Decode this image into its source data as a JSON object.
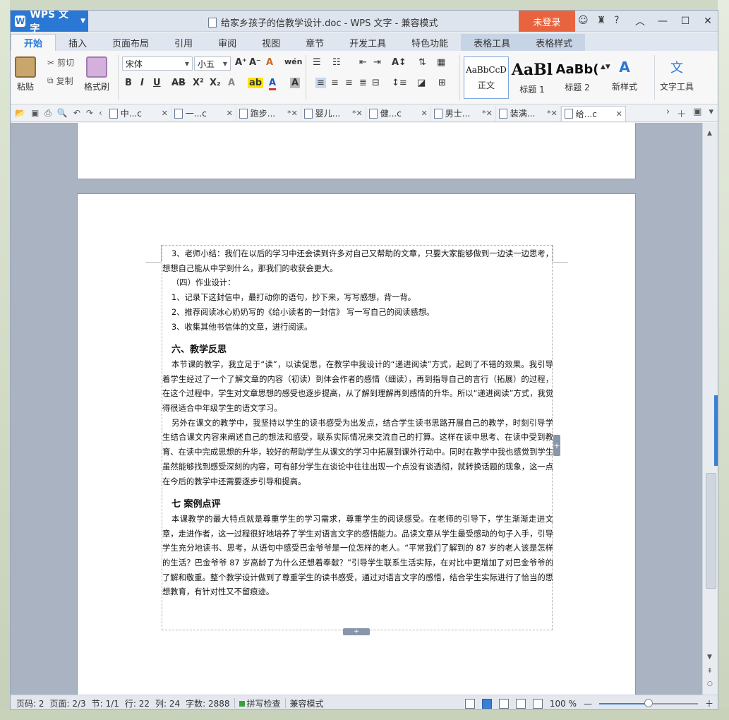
{
  "window": {
    "app_name": "WPS 文字",
    "title": "给家乡孩子的信教学设计.doc - WPS 文字 - 兼容模式",
    "login_label": "未登录"
  },
  "tabs": [
    {
      "label": "开始",
      "active": true
    },
    {
      "label": "插入"
    },
    {
      "label": "页面布局"
    },
    {
      "label": "引用"
    },
    {
      "label": "审阅"
    },
    {
      "label": "视图"
    },
    {
      "label": "章节"
    },
    {
      "label": "开发工具"
    },
    {
      "label": "特色功能"
    },
    {
      "label": "表格工具",
      "contextual": true
    },
    {
      "label": "表格样式",
      "contextual": true
    }
  ],
  "ribbon": {
    "paste": "粘贴",
    "cut": "剪切",
    "copy": "复制",
    "format_painter": "格式刷",
    "font_name": "宋体",
    "font_size": "小五",
    "styles": [
      {
        "sample": "AaBbCcD",
        "caption": "正文"
      },
      {
        "sample": "AaBl",
        "caption": "标题 1"
      },
      {
        "sample": "AaBb(",
        "caption": "标题 2"
      }
    ],
    "new_style": "新样式",
    "text_tools": "文字工具"
  },
  "doc_tabs": [
    {
      "label": "中...c",
      "modified": false
    },
    {
      "label": "一...c",
      "modified": false
    },
    {
      "label": "跑步...",
      "modified": true
    },
    {
      "label": "婴儿...",
      "modified": true
    },
    {
      "label": "健...c",
      "modified": false
    },
    {
      "label": "男士...",
      "modified": true
    },
    {
      "label": "装满...",
      "modified": true
    },
    {
      "label": "给...c",
      "modified": false,
      "active": true
    }
  ],
  "document": {
    "paragraphs_a": [
      "3、老师小结：我们在以后的学习中还会读到许多对自己又帮助的文章，只要大家能够做到一边读一边思考，想想自己能从中学到什么，那我们的收获会更大。",
      "（四）作业设计：",
      "1、记录下这封信中，最打动你的语句，抄下来，写写感想，背一背。",
      "2、推荐阅读冰心奶奶写的《给小读者的一封信》 写一写自己的阅读感想。",
      "3、收集其他书信体的文章，进行阅读。"
    ],
    "heading_6": "六、教学反思",
    "paragraphs_b": [
      "本节课的教学，我立足于“读”，以读促思，在教学中我设计的“递进阅读”方式，起到了不错的效果。我引导着学生经过了一个了解文章的内容（初读）到体会作者的感情（细读），再到指导自己的言行（拓展）的过程，在这个过程中，学生对文章思想的感受也逐步提高，从了解到理解再到感情的升华。所以“递进阅读”方式，我觉得很适合中年级学生的语文学习。",
      "另外在课文的教学中，我坚持以学生的读书感受为出发点，结合学生读书思路开展自己的教学，时刻引导学生结合课文内容来阐述自己的想法和感受，联系实际情况来交流自己的打算。这样在读中思考、在读中受到教育、在读中完成思想的升华，较好的帮助学生从课文的学习中拓展到课外行动中。同时在教学中我也感觉到学生虽然能够找到感受深刻的内容，可有部分学生在谈论中往往出现一个点没有谈透彻，就转换话题的现象，这一点在今后的教学中还需要逐步引导和提高。"
    ],
    "heading_7": "七 案例点评",
    "paragraphs_c": [
      "本课教学的最大特点就是尊重学生的学习需求，尊重学生的阅读感受。在老师的引导下，学生渐渐走进文章，走进作者，这一过程很好地培养了学生对语言文字的感悟能力。品读文章从学生最受感动的句子入手，引导学生充分地读书、思考，从语句中感受巴金爷爷是一位怎样的老人。“平常我们了解到的 87 岁的老人该是怎样的生活？巴金爷爷 87 岁高龄了为什么还想着奉献？”引导学生联系生活实际，在对比中更增加了对巴金爷爷的了解和敬重。整个教学设计做到了尊重学生的读书感受，通过对语言文字的感悟，结合学生实际进行了恰当的思想教育，有针对性又不留痕迹。"
    ]
  },
  "status": {
    "page_code": "页码: 2",
    "page": "页面: 2/3",
    "section": "节: 1/1",
    "row": "行: 22",
    "col": "列: 24",
    "word_count": "字数: 2888",
    "spell_check": "拼写检查",
    "compat_mode": "兼容模式",
    "zoom": "100 %",
    "zoom_fraction": 0.5
  }
}
